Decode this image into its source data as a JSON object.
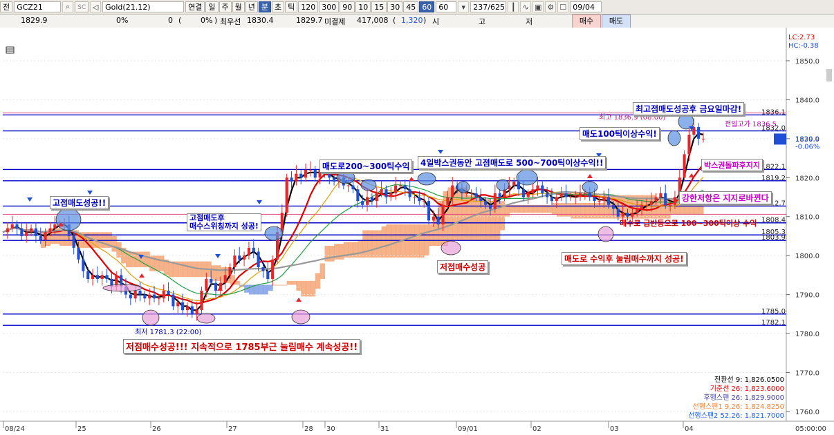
{
  "toolbar": {
    "mode_label": "전",
    "symbol": "GCZ21",
    "search_icon": "search-icon",
    "sc_label": "SC",
    "speaker_icon": "speaker-icon",
    "product_name": "Gold(21.12)",
    "items": [
      "연결",
      "일",
      "주",
      "월",
      "년",
      "분",
      "초",
      "틱",
      "120",
      "300",
      "90",
      "10",
      "15",
      "30",
      "45",
      "60"
    ],
    "selected_period": "분",
    "selected_interval": "60",
    "interval_value": "60",
    "count_value": "237",
    "count_total": "/625",
    "date_value": "09/04"
  },
  "quote": {
    "price": "1829.9",
    "change_pct": "0%",
    "change": "0",
    "paren_open": "(",
    "pct2": "0%",
    "paren_close": ")",
    "best_bid_label": "최우선",
    "best_bid": "1830.4",
    "best_ask": "1829.7",
    "open_interest_label": "미결제",
    "open_interest": "417,008",
    "oi_paren_open": "(",
    "oi_change": "1,320",
    "oi_paren_close": ")",
    "open_label": "시",
    "high_label": "고",
    "low_label": "저",
    "buy_label": "매수",
    "sell_label": "매도"
  },
  "chart_data": {
    "type": "candlestick",
    "x_labels": [
      "08/24",
      "25",
      "26",
      "27",
      "28",
      "30",
      "31",
      "09/01",
      "02",
      "03",
      "04"
    ],
    "y_ticks": [
      1850.0,
      1840.0,
      1830.0,
      1820.0,
      1810.0,
      1800.0,
      1790.0,
      1780.0,
      1770.0,
      1760.0
    ],
    "y_tick_labels": [
      "1850.0",
      "1840.0",
      "1830.0",
      "1820.0",
      "1810.0",
      "1800.0",
      "1790.0",
      "1780.0",
      "1770.0",
      "1760.0"
    ],
    "ylim": [
      1757.5,
      1858.5
    ],
    "lc_label": "LC:2.73",
    "hc_label": "HC:-0.38",
    "time_label": "05:00:00",
    "current_price_label": "1829.9",
    "current_change_label": "-0.06%",
    "colors": {
      "up": "#e8262a",
      "down": "#1f4fd6",
      "cloud_up": "#f4a574",
      "cloud_down": "#7f9fe6",
      "hline": "#0000c8"
    },
    "horizontal_lines": [
      {
        "value": 1836.1,
        "label": "1836.1"
      },
      {
        "value": 1832.0,
        "label": "1832.0"
      },
      {
        "value": 1822.1,
        "label": "1822.1"
      },
      {
        "value": 1819.2,
        "label": "1819.2"
      },
      {
        "value": 1812.7,
        "label": "1812.7"
      },
      {
        "value": 1808.4,
        "label": "1808.4"
      },
      {
        "value": 1805.3,
        "label": "1805.3"
      },
      {
        "value": 1803.9,
        "label": "1803.9"
      },
      {
        "value": 1785.0,
        "label": "1785.0"
      },
      {
        "value": 1782.1,
        "label": "1782.1"
      }
    ],
    "close_series": [
      1806,
      1807,
      1808,
      1807,
      1805,
      1806,
      1807,
      1805,
      1804,
      1806,
      1807,
      1808,
      1808,
      1808,
      1805,
      1802,
      1799,
      1796,
      1794,
      1795,
      1794,
      1795,
      1794,
      1792,
      1795,
      1792,
      1790,
      1789,
      1791,
      1790,
      1789,
      1790,
      1789,
      1789,
      1791,
      1790,
      1787,
      1788,
      1786,
      1787,
      1785,
      1786,
      1791,
      1794,
      1793,
      1791,
      1793,
      1795,
      1797,
      1800,
      1799,
      1800,
      1802,
      1801,
      1797,
      1796,
      1794,
      1799,
      1806,
      1811,
      1820,
      1819,
      1821,
      1820,
      1822,
      1822,
      1820,
      1822,
      1821,
      1820,
      1819,
      1820,
      1818,
      1818,
      1817,
      1814,
      1813,
      1815,
      1814,
      1816,
      1817,
      1815,
      1816,
      1818,
      1818,
      1817,
      1815,
      1815,
      1814,
      1814,
      1809,
      1810,
      1808,
      1813,
      1815,
      1818,
      1817,
      1816,
      1816,
      1816,
      1815,
      1814,
      1813,
      1812,
      1816,
      1815,
      1817,
      1818,
      1819,
      1817,
      1815,
      1816,
      1817,
      1818,
      1816,
      1815,
      1814,
      1815,
      1816,
      1815,
      1815,
      1815,
      1816,
      1816,
      1815,
      1814,
      1814,
      1815,
      1813,
      1812,
      1810,
      1811,
      1810,
      1811,
      1812,
      1813,
      1813,
      1814,
      1815,
      1816,
      1813,
      1813,
      1815,
      1820,
      1826,
      1831,
      1833,
      1830,
      1830
    ],
    "lines": [
      {
        "name": "전환선 9",
        "value": "1,826.0500",
        "color": "#000000"
      },
      {
        "name": "기준선 26",
        "value": "1,823.6000",
        "color": "#e00000"
      },
      {
        "name": "후행스팬 26",
        "value": "1,829.9000",
        "color": "#4040a0"
      },
      {
        "name": "선행스팬1 9,26",
        "value": "1,824.8250",
        "color": "#f08030"
      },
      {
        "name": "선행스팬2 52,26",
        "value": "1,821.7000",
        "color": "#2060e0"
      }
    ],
    "price_labels": [
      {
        "text": "최고 1836.9 (08:00)"
      },
      {
        "text": "전일고가 1836.5"
      },
      {
        "text": "최저 1781.3 (22:00)"
      }
    ],
    "annotations": [
      {
        "text": "최고점매도성공후 금요일마감!"
      },
      {
        "text": "매도100틱이상수익!"
      },
      {
        "text": "4일박스권동안 고점매도로 500~700틱이상수익!!"
      },
      {
        "text": "매도로200~300틱수익"
      },
      {
        "text": "박스권돌파후지지"
      },
      {
        "text": "강한저항은 지지로바뀐다"
      },
      {
        "text": "고점매도성공!!"
      },
      {
        "text": "고점매도후"
      },
      {
        "text": "매수스위칭까지 성공!"
      },
      {
        "text": "매수로 급반등으로 100~300틱이상 수익"
      },
      {
        "text": "저점매수성공"
      },
      {
        "text": "매도로 수익후 눌림매수까지 성공!"
      },
      {
        "text": "저점매수성공!!! 지속적으로 1785부근 눌림매수 계속성공!!"
      }
    ]
  }
}
